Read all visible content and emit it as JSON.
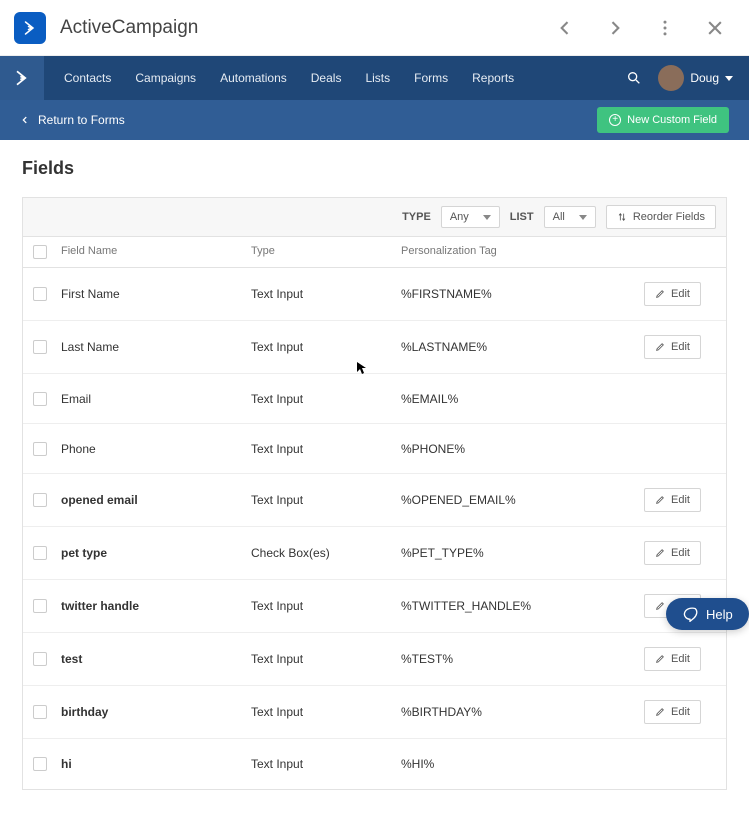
{
  "app": {
    "title": "ActiveCampaign"
  },
  "nav": {
    "items": [
      "Contacts",
      "Campaigns",
      "Automations",
      "Deals",
      "Lists",
      "Forms",
      "Reports"
    ],
    "user": "Doug"
  },
  "subbar": {
    "return": "Return to Forms",
    "new_field": "New Custom Field"
  },
  "page": {
    "title": "Fields"
  },
  "toolbar": {
    "type_label": "TYPE",
    "type_value": "Any",
    "list_label": "LIST",
    "list_value": "All",
    "reorder": "Reorder Fields"
  },
  "table": {
    "headers": {
      "name": "Field Name",
      "type": "Type",
      "tag": "Personalization Tag"
    },
    "edit_label": "Edit",
    "rows": [
      {
        "name": "First Name",
        "type": "Text Input",
        "tag": "%FIRSTNAME%",
        "bold": false,
        "editable": true
      },
      {
        "name": "Last Name",
        "type": "Text Input",
        "tag": "%LASTNAME%",
        "bold": false,
        "editable": true
      },
      {
        "name": "Email",
        "type": "Text Input",
        "tag": "%EMAIL%",
        "bold": false,
        "editable": false
      },
      {
        "name": "Phone",
        "type": "Text Input",
        "tag": "%PHONE%",
        "bold": false,
        "editable": false
      },
      {
        "name": "opened email",
        "type": "Text Input",
        "tag": "%OPENED_EMAIL%",
        "bold": true,
        "editable": true
      },
      {
        "name": "pet type",
        "type": "Check Box(es)",
        "tag": "%PET_TYPE%",
        "bold": true,
        "editable": true
      },
      {
        "name": "twitter handle",
        "type": "Text Input",
        "tag": "%TWITTER_HANDLE%",
        "bold": true,
        "editable": true
      },
      {
        "name": "test",
        "type": "Text Input",
        "tag": "%TEST%",
        "bold": true,
        "editable": true
      },
      {
        "name": "birthday",
        "type": "Text Input",
        "tag": "%BIRTHDAY%",
        "bold": true,
        "editable": true
      },
      {
        "name": "hi",
        "type": "Text Input",
        "tag": "%HI%",
        "bold": true,
        "editable": false
      }
    ]
  },
  "help": {
    "label": "Help"
  }
}
